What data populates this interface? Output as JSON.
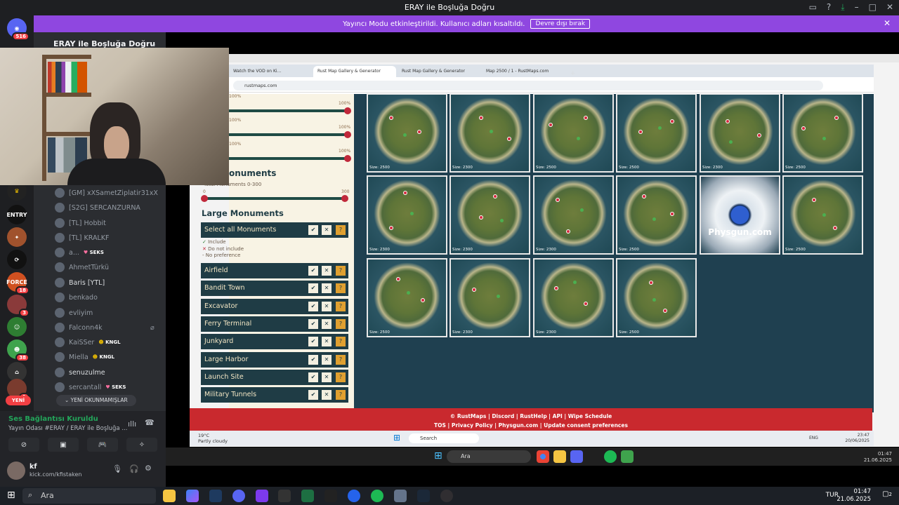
{
  "app": {
    "title": "ERAY ile Boşluğa Doğru"
  },
  "banner": {
    "text": "Yayıncı Modu etkinleştirildi. Kullanıcı adları kısaltıldı.",
    "button": "Devre dışı bırak"
  },
  "rail_badges": [
    "516",
    "18",
    "3",
    "38",
    "1"
  ],
  "server": {
    "name": "ERAY ile Boşluğa Doğru"
  },
  "members": [
    {
      "name": "[GM] xXSametZiplatir31xX",
      "tag": ""
    },
    {
      "name": "[S2G] SERCANZURNA",
      "tag": ""
    },
    {
      "name": "[TL] Hobbit",
      "tag": ""
    },
    {
      "name": "[TL] KRALKF",
      "tag": ""
    },
    {
      "name": "a...",
      "tag": "SEKS"
    },
    {
      "name": "AhmetTürkü",
      "tag": ""
    },
    {
      "name": "Baris [YTL]",
      "tag": ""
    },
    {
      "name": "benkado",
      "tag": ""
    },
    {
      "name": "evliyim",
      "tag": ""
    },
    {
      "name": "Falconn4k",
      "tag": ""
    },
    {
      "name": "KaiSSer",
      "tag": "KNGL"
    },
    {
      "name": "Miella",
      "tag": "KNGL"
    },
    {
      "name": "senuzulme",
      "tag": ""
    },
    {
      "name": "sercantall",
      "tag": "SEKS"
    }
  ],
  "new_pill": "YENİ",
  "unread": "YENİ OKUNMAMIŞLAR",
  "voice": {
    "status": "Ses Bağlantısı Kuruldu",
    "channel": "Yayın Odası #ERAY / ERAY ile Boşluğa ..."
  },
  "user": {
    "name": "kf",
    "status": "kick.com/kfistaken"
  },
  "browser": {
    "tabs": [
      "Watch the VOD on Ki...",
      "Rust Map Gallery & Generator",
      "Rust Map Gallery & Generator",
      "Map 2500 / 1 - RustMaps.com"
    ],
    "url": "rustmaps.com"
  },
  "filters": {
    "slider_labels": [
      "100%",
      "100%",
      "100%",
      "100%",
      "100%",
      "100%"
    ],
    "monuments_heading": "onuments",
    "monuments_sub": "Total Monuments 0-300",
    "range_min": "0",
    "range_max": "300",
    "large_heading": "Large Monuments",
    "select_all": "Select all Monuments",
    "legend": [
      "Include",
      "Do not include",
      "No preference"
    ],
    "items": [
      "Airfield",
      "Bandit Town",
      "Excavator",
      "Ferry Terminal",
      "Junkyard",
      "Large Harbor",
      "Launch Site",
      "Military Tunnels"
    ]
  },
  "maps": [
    {
      "size": "Size: 2500"
    },
    {
      "size": "Size: 2300"
    },
    {
      "size": "Size: 2500"
    },
    {
      "size": "Size: 2500"
    },
    {
      "size": "Size: 2300"
    },
    {
      "size": "Size: 2500"
    },
    {
      "size": "Size: 2300"
    },
    {
      "size": "Size: 2300"
    },
    {
      "size": "Size: 2300"
    },
    {
      "size": "Size: 2500"
    },
    {
      "size": ""
    },
    {
      "size": "Size: 2500"
    },
    {
      "size": "Size: 2500"
    },
    {
      "size": "Size: 2300"
    },
    {
      "size": "Size: 2300"
    },
    {
      "size": "Size: 2500"
    }
  ],
  "ad": {
    "text": "Physgun.com"
  },
  "site_footer": {
    "line1": "© RustMaps | Discord | RustHelp | API | Wipe Schedule",
    "line2": "TOS | Privacy Policy | Physgun.com | Update consent preferences"
  },
  "inner_taskbar": {
    "weather_temp": "19°C",
    "weather_text": "Partly cloudy",
    "search": "Search",
    "lang": "ENG",
    "time": "23:47",
    "date": "20/06/2025"
  },
  "stream_taskbar": {
    "search": "Ara",
    "time": "01:47",
    "date": "21.06.2025"
  },
  "win_taskbar": {
    "search": "Ara",
    "lang": "TUR",
    "time": "01:47",
    "date": "21.06.2025",
    "notif": "2"
  },
  "colors": {
    "accent": "#8f47e0",
    "discord_bg": "#2b2d31",
    "rust_red": "#c9292e",
    "map_bg": "#1f4050"
  }
}
